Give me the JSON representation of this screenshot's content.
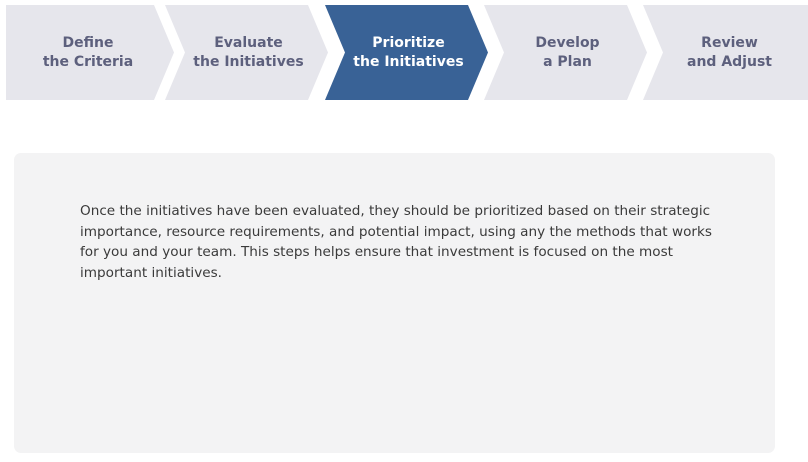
{
  "steps": [
    {
      "label": "Define\nthe Criteria",
      "active": false
    },
    {
      "label": "Evaluate\nthe Initiatives",
      "active": false
    },
    {
      "label": "Prioritize\nthe Initiatives",
      "active": true
    },
    {
      "label": "Develop\na Plan",
      "active": false
    },
    {
      "label": "Review\nand Adjust",
      "active": false
    }
  ],
  "content": {
    "description": "Once the initiatives have been evaluated, they should be prioritized based on their strategic importance, resource requirements, and potential impact, using any the methods that works for you and your team. This steps helps ensure that investment is focused on the most important initiatives."
  },
  "colors": {
    "active_step": "#396296",
    "inactive_step": "#e6e6ec",
    "inactive_text": "#5d607d",
    "panel_background": "#f3f3f4"
  }
}
